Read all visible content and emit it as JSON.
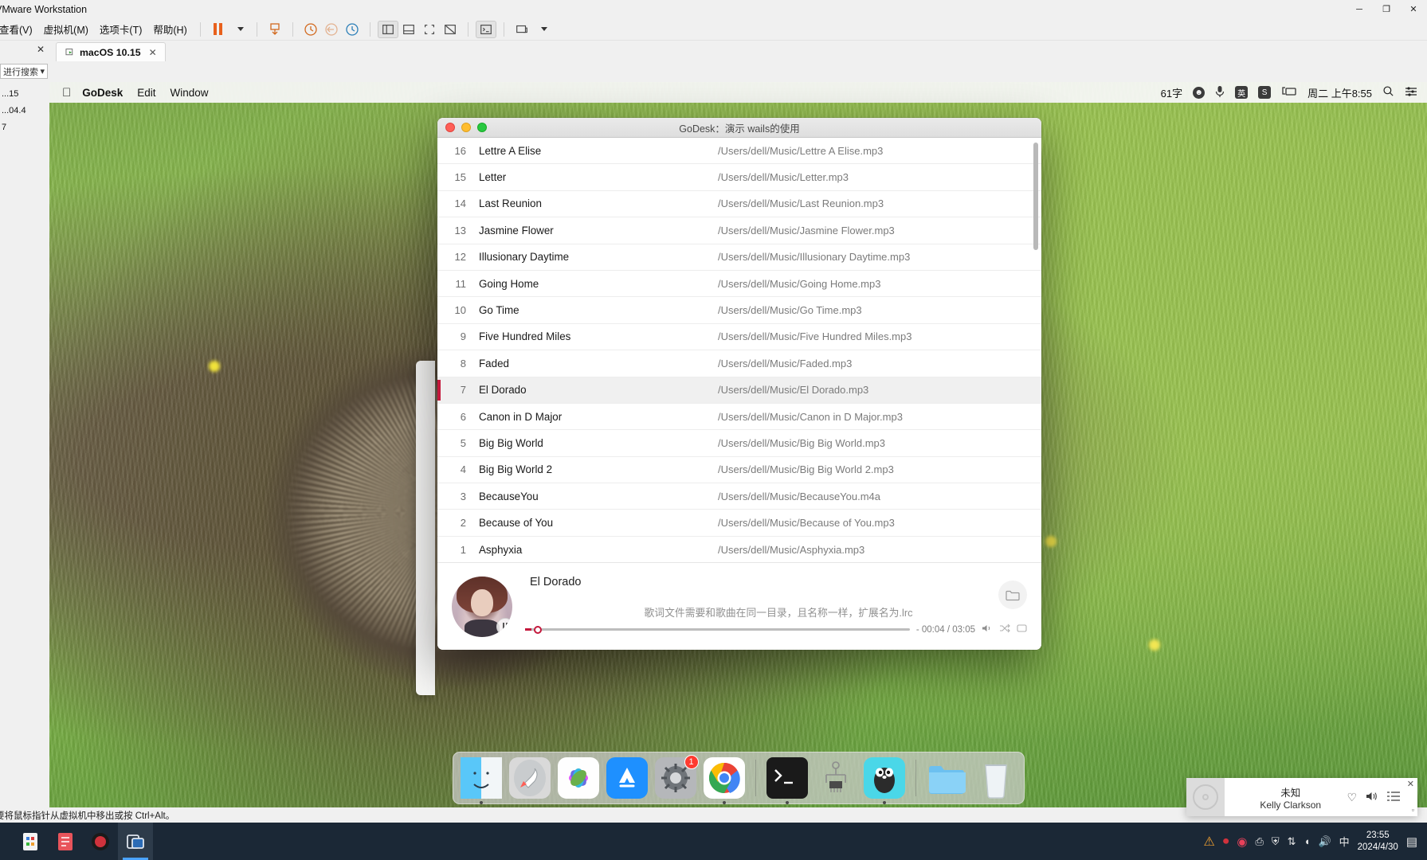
{
  "vmware": {
    "window_title": "VMware Workstation",
    "window_controls": {
      "minimize": "─",
      "maximize": "❐",
      "close": "✕"
    },
    "menus": [
      {
        "label": "查看(V)",
        "name": "menu-view"
      },
      {
        "label": "虚拟机(M)",
        "name": "menu-vm"
      },
      {
        "label": "选项卡(T)",
        "name": "menu-tabs"
      },
      {
        "label": "帮助(H)",
        "name": "menu-help"
      }
    ],
    "search_placeholder": "进行搜索",
    "tree_items": [
      "...15",
      "...04.4",
      "7"
    ],
    "tab": {
      "label": "macOS 10.15",
      "close": "✕"
    },
    "sidepanel_close": "✕",
    "status_text": "要将鼠标指针从虚拟机中移出或按 Ctrl+Alt。"
  },
  "windows_taskbar": {
    "time": "23:55",
    "date": "2024/4/30",
    "ime": "中",
    "apps": [
      {
        "name": "taskbar-app-explorer",
        "color": "#f4f4f4"
      },
      {
        "name": "taskbar-app-notes",
        "color": "#e8545b"
      },
      {
        "name": "taskbar-app-recorder",
        "color": "#d0323c"
      },
      {
        "name": "taskbar-app-vmware",
        "color": "#4aa3ff"
      }
    ],
    "tray": [
      {
        "name": "tray-warning-icon",
        "glyph": "⚠"
      },
      {
        "name": "tray-record-icon",
        "glyph": "⏺"
      },
      {
        "name": "tray-music-icon",
        "glyph": "♫"
      },
      {
        "name": "tray-network-icon",
        "glyph": "🖧"
      },
      {
        "name": "tray-shield-icon",
        "glyph": "⛨"
      },
      {
        "name": "tray-updown-icon",
        "glyph": "⇅"
      },
      {
        "name": "tray-wifi-icon",
        "glyph": "◠"
      },
      {
        "name": "tray-volume-icon",
        "glyph": "🔊"
      }
    ]
  },
  "macos": {
    "menubar": {
      "apple": "",
      "items": [
        "GoDesk",
        "Edit",
        "Window"
      ],
      "status": {
        "word_count": "61字",
        "emoji_icon": "☻",
        "mic_icon": "♑",
        "ime_label": "英",
        "sogou_label": "S",
        "display_icon": "⬚",
        "clock": "周二 上午8:55",
        "search_icon": "⌕",
        "control_center_icon": "☰"
      }
    },
    "dock": {
      "items": [
        {
          "name": "dock-finder",
          "label": "Finder",
          "running": true
        },
        {
          "name": "dock-launchpad",
          "label": "Launchpad",
          "running": false
        },
        {
          "name": "dock-photos",
          "label": "Photos",
          "running": false
        },
        {
          "name": "dock-app-store",
          "label": "App Store",
          "running": false
        },
        {
          "name": "dock-system-preferences",
          "label": "System Preferences",
          "running": false,
          "badge": "1"
        },
        {
          "name": "dock-chrome",
          "label": "Google Chrome",
          "running": true
        },
        {
          "name": "dock-terminal",
          "label": "Terminal",
          "running": true
        },
        {
          "name": "dock-circuit-app",
          "label": "Circuit",
          "running": false
        },
        {
          "name": "dock-gopher-app",
          "label": "GoLand",
          "running": true
        },
        {
          "name": "dock-folder",
          "label": "Downloads",
          "running": false
        },
        {
          "name": "dock-trash",
          "label": "Trash",
          "running": false
        }
      ]
    }
  },
  "godesk": {
    "title": "GoDesk：演示 wails的使用",
    "back_tab_icon": "←",
    "folder_icon": "❐",
    "songs": [
      {
        "index": "1",
        "name": "Asphyxia",
        "path": "/Users/dell/Music/Asphyxia.mp3",
        "selected": false
      },
      {
        "index": "2",
        "name": "Because of You",
        "path": "/Users/dell/Music/Because of You.mp3",
        "selected": false
      },
      {
        "index": "3",
        "name": "BecauseYou",
        "path": "/Users/dell/Music/BecauseYou.m4a",
        "selected": false
      },
      {
        "index": "4",
        "name": "Big Big World 2",
        "path": "/Users/dell/Music/Big Big World 2.mp3",
        "selected": false
      },
      {
        "index": "5",
        "name": "Big Big World",
        "path": "/Users/dell/Music/Big Big World.mp3",
        "selected": false
      },
      {
        "index": "6",
        "name": "Canon in D Major",
        "path": "/Users/dell/Music/Canon in D Major.mp3",
        "selected": false
      },
      {
        "index": "7",
        "name": "El Dorado",
        "path": "/Users/dell/Music/El Dorado.mp3",
        "selected": true
      },
      {
        "index": "8",
        "name": "Faded",
        "path": "/Users/dell/Music/Faded.mp3",
        "selected": false
      },
      {
        "index": "9",
        "name": "Five Hundred Miles",
        "path": "/Users/dell/Music/Five Hundred Miles.mp3",
        "selected": false
      },
      {
        "index": "10",
        "name": "Go Time",
        "path": "/Users/dell/Music/Go Time.mp3",
        "selected": false
      },
      {
        "index": "11",
        "name": "Going Home",
        "path": "/Users/dell/Music/Going Home.mp3",
        "selected": false
      },
      {
        "index": "12",
        "name": "Illusionary Daytime",
        "path": "/Users/dell/Music/Illusionary Daytime.mp3",
        "selected": false
      },
      {
        "index": "13",
        "name": "Jasmine Flower",
        "path": "/Users/dell/Music/Jasmine Flower.mp3",
        "selected": false
      },
      {
        "index": "14",
        "name": "Last Reunion",
        "path": "/Users/dell/Music/Last Reunion.mp3",
        "selected": false
      },
      {
        "index": "15",
        "name": "Letter",
        "path": "/Users/dell/Music/Letter.mp3",
        "selected": false
      },
      {
        "index": "16",
        "name": "Lettre A Elise",
        "path": "/Users/dell/Music/Lettre A Elise.mp3",
        "selected": false
      }
    ],
    "player": {
      "song_title": "El Dorado",
      "lyric_hint": "歌词文件需要和歌曲在同一目录，且名称一样，扩展名为.lrc",
      "time": "- 00:04 / 03:05",
      "volume_icon": "🔊",
      "shuffle_icon": "⤨",
      "repeat_icon": "❐",
      "progress_percent": 2
    },
    "accent_color": "#c4183c"
  },
  "music_widget": {
    "title": "未知",
    "artist": "Kelly Clarkson",
    "like_icon": "♡",
    "volume_icon": "🔊",
    "playlist_icon": "☰",
    "close_icon": "✕",
    "minimize_icon": "▫"
  }
}
